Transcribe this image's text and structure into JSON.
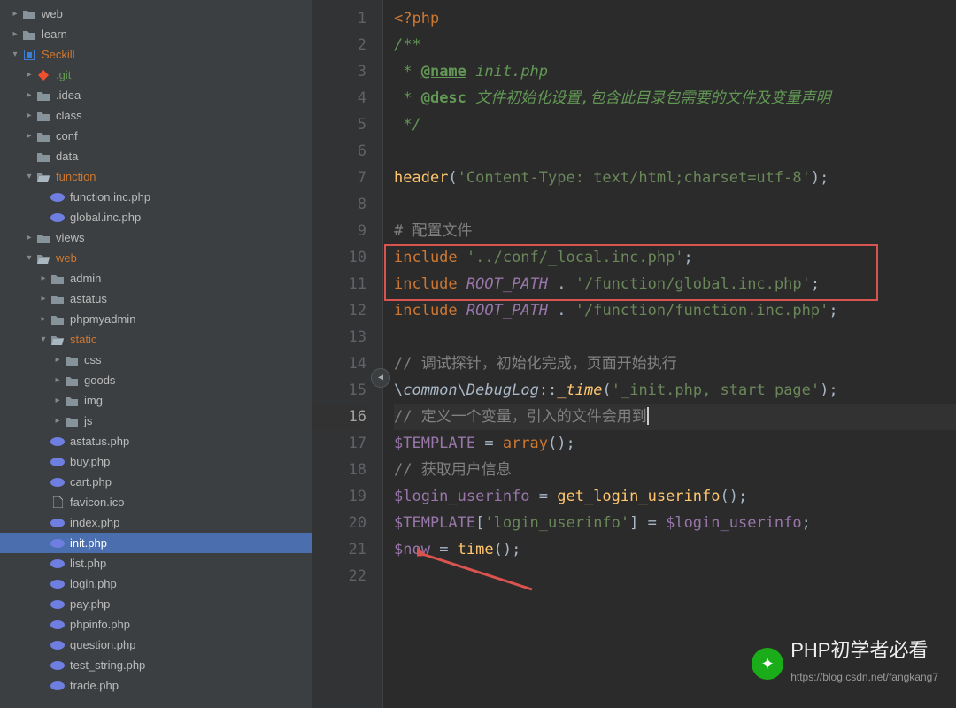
{
  "tree": [
    {
      "depth": 0,
      "chev": "closed",
      "icon": "folder",
      "label": "web"
    },
    {
      "depth": 0,
      "chev": "closed",
      "icon": "folder",
      "label": "learn"
    },
    {
      "depth": 0,
      "chev": "open",
      "icon": "module",
      "label": "Seckill",
      "color": "orange"
    },
    {
      "depth": 1,
      "chev": "closed",
      "icon": "git",
      "label": ".git",
      "color": "teal"
    },
    {
      "depth": 1,
      "chev": "closed",
      "icon": "folder",
      "label": ".idea"
    },
    {
      "depth": 1,
      "chev": "closed",
      "icon": "folder",
      "label": "class"
    },
    {
      "depth": 1,
      "chev": "closed",
      "icon": "folder",
      "label": "conf"
    },
    {
      "depth": 1,
      "chev": "none",
      "icon": "folder",
      "label": "data"
    },
    {
      "depth": 1,
      "chev": "open",
      "icon": "folder-open",
      "label": "function",
      "color": "orange"
    },
    {
      "depth": 2,
      "chev": "none",
      "icon": "php",
      "label": "function.inc.php"
    },
    {
      "depth": 2,
      "chev": "none",
      "icon": "php",
      "label": "global.inc.php"
    },
    {
      "depth": 1,
      "chev": "closed",
      "icon": "folder",
      "label": "views"
    },
    {
      "depth": 1,
      "chev": "open",
      "icon": "folder-open",
      "label": "web",
      "color": "orange"
    },
    {
      "depth": 2,
      "chev": "closed",
      "icon": "folder",
      "label": "admin"
    },
    {
      "depth": 2,
      "chev": "closed",
      "icon": "folder",
      "label": "astatus"
    },
    {
      "depth": 2,
      "chev": "closed",
      "icon": "folder",
      "label": "phpmyadmin"
    },
    {
      "depth": 2,
      "chev": "open",
      "icon": "folder-open",
      "label": "static",
      "color": "orange"
    },
    {
      "depth": 3,
      "chev": "closed",
      "icon": "folder",
      "label": "css"
    },
    {
      "depth": 3,
      "chev": "closed",
      "icon": "folder",
      "label": "goods"
    },
    {
      "depth": 3,
      "chev": "closed",
      "icon": "folder",
      "label": "img"
    },
    {
      "depth": 3,
      "chev": "closed",
      "icon": "folder",
      "label": "js"
    },
    {
      "depth": 2,
      "chev": "none",
      "icon": "php",
      "label": "astatus.php"
    },
    {
      "depth": 2,
      "chev": "none",
      "icon": "php",
      "label": "buy.php"
    },
    {
      "depth": 2,
      "chev": "none",
      "icon": "php",
      "label": "cart.php"
    },
    {
      "depth": 2,
      "chev": "none",
      "icon": "file",
      "label": "favicon.ico"
    },
    {
      "depth": 2,
      "chev": "none",
      "icon": "php",
      "label": "index.php"
    },
    {
      "depth": 2,
      "chev": "none",
      "icon": "php",
      "label": "init.php",
      "selected": true
    },
    {
      "depth": 2,
      "chev": "none",
      "icon": "php",
      "label": "list.php"
    },
    {
      "depth": 2,
      "chev": "none",
      "icon": "php",
      "label": "login.php"
    },
    {
      "depth": 2,
      "chev": "none",
      "icon": "php",
      "label": "pay.php"
    },
    {
      "depth": 2,
      "chev": "none",
      "icon": "php",
      "label": "phpinfo.php"
    },
    {
      "depth": 2,
      "chev": "none",
      "icon": "php",
      "label": "question.php"
    },
    {
      "depth": 2,
      "chev": "none",
      "icon": "php",
      "label": "test_string.php"
    },
    {
      "depth": 2,
      "chev": "none",
      "icon": "php",
      "label": "trade.php"
    }
  ],
  "line_count": 22,
  "highlight_line": 16,
  "code_lines": [
    [
      {
        "c": "kw",
        "t": "<?php"
      }
    ],
    [
      {
        "c": "doc",
        "t": "/**"
      }
    ],
    [
      {
        "c": "doc",
        "t": " * "
      },
      {
        "c": "doc-tag",
        "t": "@name"
      },
      {
        "c": "doc",
        "t": " init.php"
      }
    ],
    [
      {
        "c": "doc",
        "t": " * "
      },
      {
        "c": "doc-tag",
        "t": "@desc"
      },
      {
        "c": "doc",
        "t": " 文件初始化设置,包含此目录包需要的文件及变量声明"
      }
    ],
    [
      {
        "c": "doc",
        "t": " */"
      }
    ],
    [],
    [
      {
        "c": "fn",
        "t": "header"
      },
      {
        "c": "op",
        "t": "("
      },
      {
        "c": "str",
        "t": "'Content-Type: text/html;charset=utf-8'"
      },
      {
        "c": "op",
        "t": ");"
      }
    ],
    [],
    [
      {
        "c": "cmt",
        "t": "# 配置文件"
      }
    ],
    [
      {
        "c": "kw",
        "t": "include "
      },
      {
        "c": "str",
        "t": "'../conf/_local.inc.php'"
      },
      {
        "c": "op",
        "t": ";"
      }
    ],
    [
      {
        "c": "kw",
        "t": "include "
      },
      {
        "c": "const",
        "t": "ROOT_PATH"
      },
      {
        "c": "op",
        "t": " . "
      },
      {
        "c": "str",
        "t": "'/function/global.inc.php'"
      },
      {
        "c": "op",
        "t": ";"
      }
    ],
    [
      {
        "c": "kw",
        "t": "include "
      },
      {
        "c": "const",
        "t": "ROOT_PATH"
      },
      {
        "c": "op",
        "t": " . "
      },
      {
        "c": "str",
        "t": "'/function/function.inc.php'"
      },
      {
        "c": "op",
        "t": ";"
      }
    ],
    [],
    [
      {
        "c": "cmt",
        "t": "// 调试探针，初始化完成，页面开始执行"
      }
    ],
    [
      {
        "c": "op",
        "t": "\\"
      },
      {
        "c": "ns",
        "t": "common"
      },
      {
        "c": "op",
        "t": "\\"
      },
      {
        "c": "ns",
        "t": "DebugLog"
      },
      {
        "c": "op",
        "t": "::"
      },
      {
        "c": "static-fn",
        "t": "_time"
      },
      {
        "c": "op",
        "t": "("
      },
      {
        "c": "str",
        "t": "'_init.php, start page'"
      },
      {
        "c": "op",
        "t": ");"
      }
    ],
    [
      {
        "c": "cmt",
        "t": "// 定义一个变量，引入的文件会用到"
      },
      {
        "cursor": true
      }
    ],
    [
      {
        "c": "var",
        "t": "$TEMPLATE"
      },
      {
        "c": "op",
        "t": " = "
      },
      {
        "c": "kw",
        "t": "array"
      },
      {
        "c": "op",
        "t": "();"
      }
    ],
    [
      {
        "c": "cmt",
        "t": "// 获取用户信息"
      }
    ],
    [
      {
        "c": "var",
        "t": "$login_userinfo"
      },
      {
        "c": "op",
        "t": " = "
      },
      {
        "c": "fn",
        "t": "get_login_userinfo"
      },
      {
        "c": "op",
        "t": "();"
      }
    ],
    [
      {
        "c": "var",
        "t": "$TEMPLATE"
      },
      {
        "c": "op",
        "t": "["
      },
      {
        "c": "str",
        "t": "'login_userinfo'"
      },
      {
        "c": "op",
        "t": "] = "
      },
      {
        "c": "var",
        "t": "$login_userinfo"
      },
      {
        "c": "op",
        "t": ";"
      }
    ],
    [
      {
        "c": "var",
        "t": "$now"
      },
      {
        "c": "op",
        "t": " = "
      },
      {
        "c": "fn",
        "t": "time"
      },
      {
        "c": "op",
        "t": "();"
      }
    ],
    []
  ],
  "watermark": {
    "title": "PHP初学者必看",
    "url": "https://blog.csdn.net/fangkang7"
  }
}
